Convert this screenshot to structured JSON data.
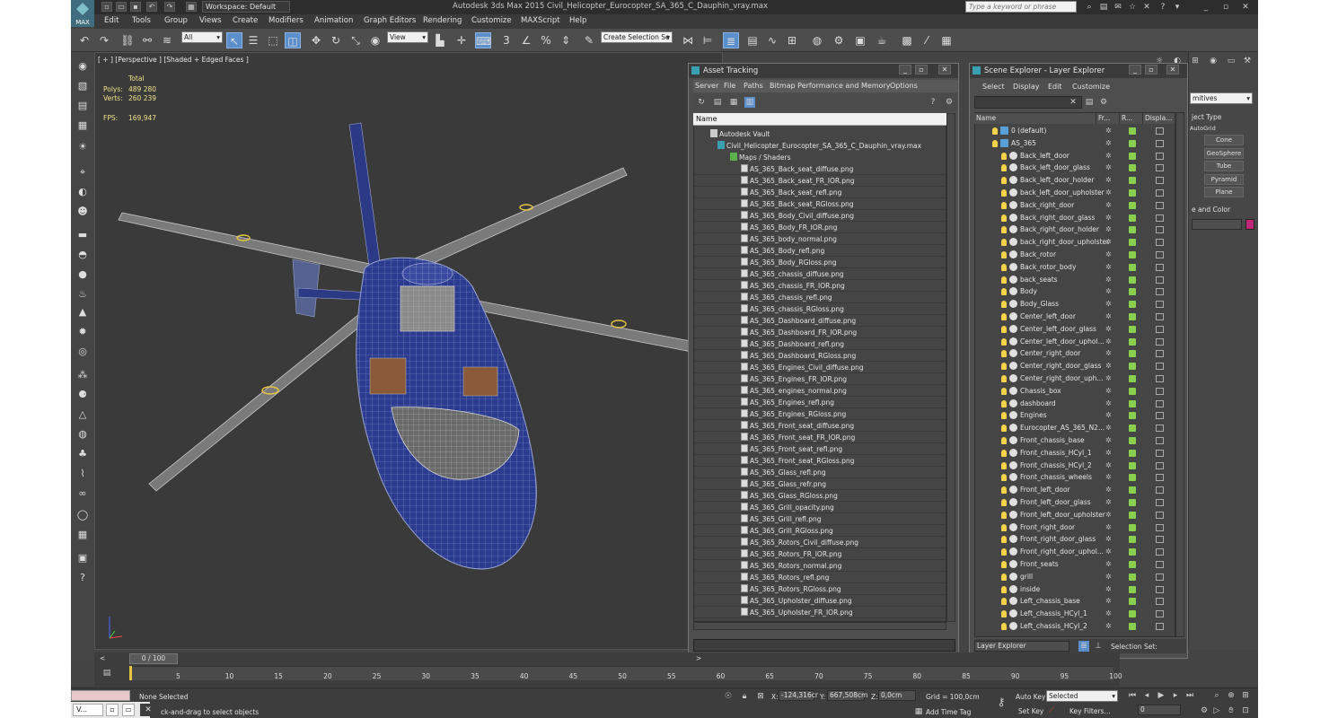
{
  "app": {
    "title": "Autodesk 3ds Max  2015    Civil_Helicopter_Eurocopter_SA_365_C_Dauphin_vray.max",
    "logo": "MAX",
    "workspace": "Workspace: Default",
    "search_placeholder": "Type a keyword or phrase"
  },
  "menubar": [
    "Edit",
    "Tools",
    "Group",
    "Views",
    "Create",
    "Modifiers",
    "Animation",
    "Graph Editors",
    "Rendering",
    "Customize",
    "MAXScript",
    "Help"
  ],
  "toolbar": {
    "selection_filter": "All",
    "ref_coord": "View",
    "named_selection": "Create Selection Se",
    "snap_label": "3"
  },
  "viewport": {
    "label": "[ + ] [Perspective ] [Shaded + Edged Faces ]",
    "stats_header": "Total",
    "polys_label": "Polys:",
    "polys_value": "489 280",
    "verts_label": "Verts:",
    "verts_value": "260 239",
    "fps_label": "FPS:",
    "fps_value": "169,947"
  },
  "asset_tracking": {
    "title": "Asset Tracking",
    "menu": [
      "Server",
      "File",
      "Paths",
      "Bitmap Performance and Memory",
      "Options"
    ],
    "column": "Name",
    "vault": "Autodesk Vault",
    "scene_file": "Civil_Helicopter_Eurocopter_SA_365_C_Dauphin_vray.max",
    "maps_folder": "Maps / Shaders",
    "files": [
      "AS_365_Back_seat_diffuse.png",
      "AS_365_Back_seat_FR_IOR.png",
      "AS_365_Back_seat_refl.png",
      "AS_365_Back_seat_RGloss.png",
      "AS_365_Body_Civil_diffuse.png",
      "AS_365_Body_FR_IOR.png",
      "AS_365_body_normal.png",
      "AS_365_Body_refl.png",
      "AS_365_Body_RGloss.png",
      "AS_365_chassis_diffuse.png",
      "AS_365_chassis_FR_IOR.png",
      "AS_365_chassis_refl.png",
      "AS_365_chassis_RGloss.png",
      "AS_365_Dashboard_diffuse.png",
      "AS_365_Dashboard_FR_IOR.png",
      "AS_365_Dashboard_refl.png",
      "AS_365_Dashboard_RGloss.png",
      "AS_365_Engines_Civil_diffuse.png",
      "AS_365_Engines_FR_IOR.png",
      "AS_365_engines_normal.png",
      "AS_365_Engines_refl.png",
      "AS_365_Engines_RGloss.png",
      "AS_365_Front_seat_diffuse.png",
      "AS_365_Front_seat_FR_IOR.png",
      "AS_365_Front_seat_refl.png",
      "AS_365_Front_seat_RGloss.png",
      "AS_365_Glass_refl.png",
      "AS_365_Glass_refr.png",
      "AS_365_Glass_RGloss.png",
      "AS_365_Grill_opacity.png",
      "AS_365_Grill_refl.png",
      "AS_365_Grill_RGloss.png",
      "AS_365_Rotors_Civil_diffuse.png",
      "AS_365_Rotors_FR_IOR.png",
      "AS_365_Rotors_normal.png",
      "AS_365_Rotors_refl.png",
      "AS_365_Rotors_RGloss.png",
      "AS_365_Upholster_diffuse.png",
      "AS_365_Upholster_FR_IOR.png"
    ]
  },
  "scene_explorer": {
    "title": "Scene Explorer - Layer Explorer",
    "menu": [
      "Select",
      "Display",
      "Edit",
      "Customize"
    ],
    "columns": [
      "Name",
      "Fr...",
      "R...",
      "Displa..."
    ],
    "default_layer": "0 (default)",
    "group_layer": "AS_365",
    "objects": [
      "Back_left_door",
      "Back_left_door_glass",
      "Back_left_door_holder",
      "back_left_door_upholster",
      "Back_right_door",
      "Back_right_door_glass",
      "Back_right_door_holder",
      "back_right_door_upholster",
      "Back_rotor",
      "Back_rotor_body",
      "back_seats",
      "Body",
      "Body_Glass",
      "Center_left_door",
      "Center_left_door_glass",
      "Center_left_door_uphol...",
      "Center_right_door",
      "Center_right_door_glass",
      "Center_right_door_uph...",
      "Chassis_box",
      "dashboard",
      "Engines",
      "Eurocopter_AS_365_N2...",
      "Front_chassis_base",
      "Front_chassis_HCyl_1",
      "Front_chassis_HCyl_2",
      "Front_chassis_wheels",
      "Front_left_door",
      "Front_left_door_glass",
      "Front_left_door_upholster",
      "Front_right_door",
      "Front_right_door_glass",
      "Front_right_door_uphol...",
      "Front_seats",
      "grill",
      "inside",
      "Left_chassis_base",
      "Left_chassis_HCyl_1",
      "Left_chassis_HCyl_2"
    ],
    "footer_layer": "Layer Explorer",
    "selection_set": "Selection Set:"
  },
  "command_panel": {
    "dropdown": "mitives",
    "rollout_object_type": "ject Type",
    "autogrid": "AutoGrid",
    "buttons": [
      "Cone",
      "GeoSphere",
      "Tube",
      "Pyramid",
      "Plane"
    ],
    "rollout_name_color": "e and Color",
    "color_swatch": "#c0267a"
  },
  "timeline": {
    "slider": "0 / 100",
    "ticks": [
      "5",
      "10",
      "15",
      "20",
      "25",
      "30",
      "35",
      "40",
      "45",
      "50",
      "55",
      "60",
      "65",
      "70",
      "75",
      "80",
      "85",
      "90",
      "95",
      "100"
    ]
  },
  "status": {
    "selection": "None Selected",
    "prompt": "ck-and-drag to select objects",
    "x_label": "X:",
    "x_value": "-124,316cr",
    "y_label": "Y:",
    "y_value": "667,508cm",
    "z_label": "Z:",
    "z_value": "0,0cm",
    "grid": "Grid = 100,0cm",
    "auto_key": "Auto Key",
    "key_mode": "Selected",
    "set_key": "Set Key",
    "key_filters": "Key Filters...",
    "frame": "0",
    "add_time_tag": "Add Time Tag"
  },
  "taskbar": {
    "item": "V..."
  }
}
